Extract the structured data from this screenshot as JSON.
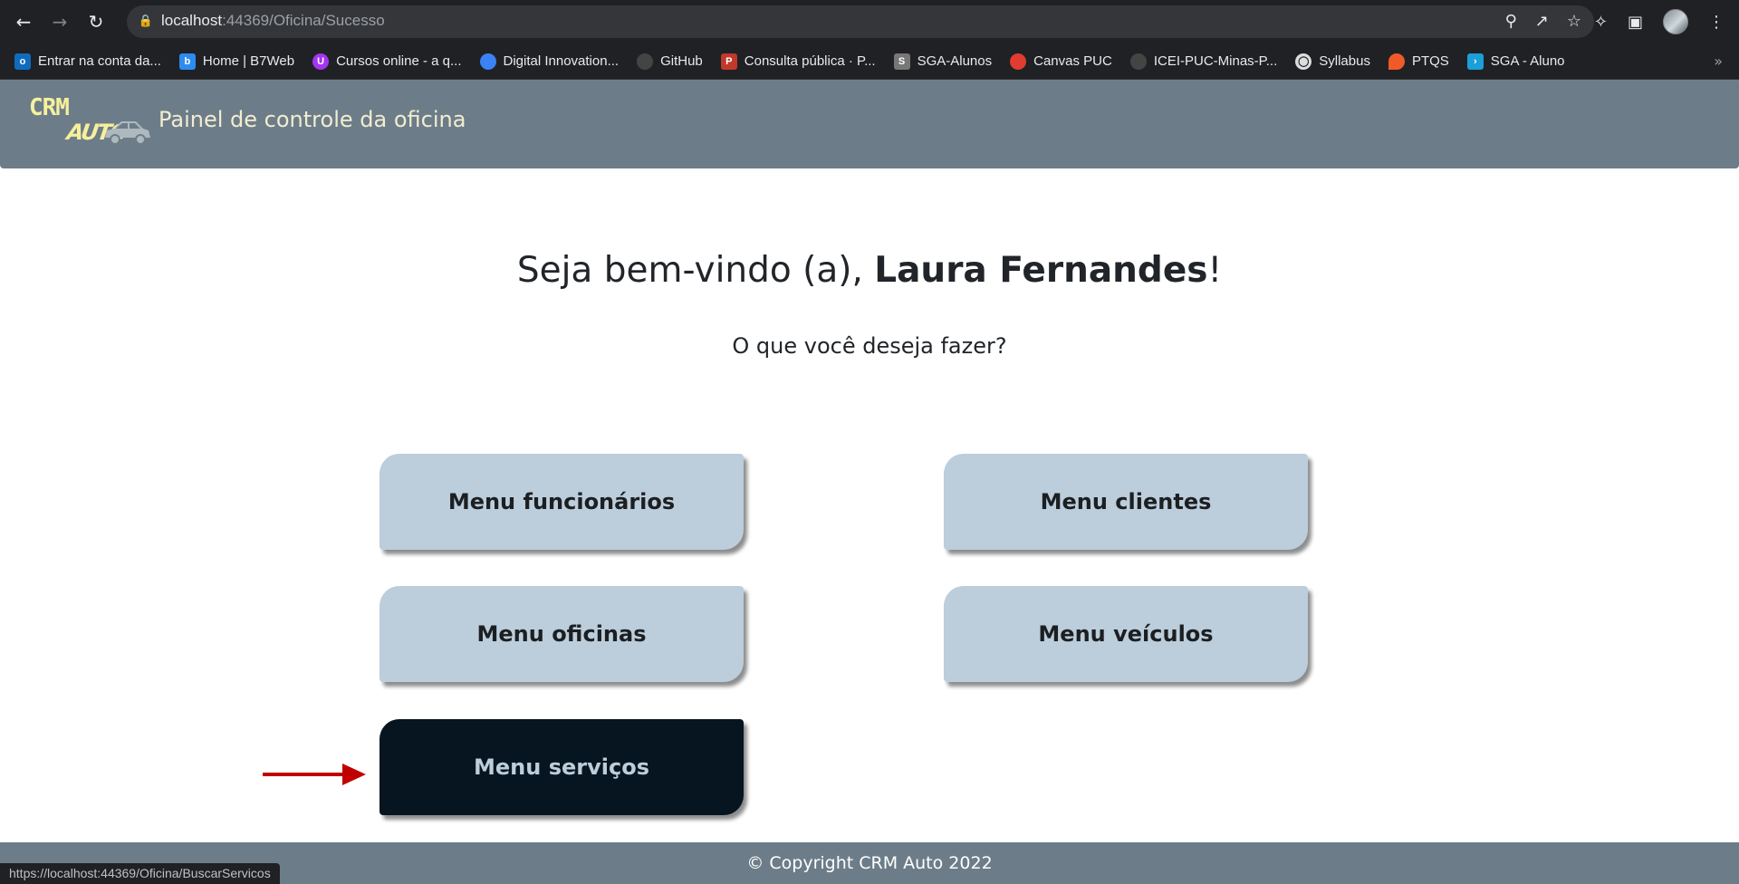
{
  "browser": {
    "url_host": "localhost",
    "url_path": ":44369/Oficina/Sucesso",
    "status_url": "https://localhost:44369/Oficina/BuscarServicos",
    "bookmarks": [
      {
        "label": "Entrar na conta da...",
        "icon": "outlook-icon",
        "color": "#0f6cbd"
      },
      {
        "label": "Home | B7Web",
        "icon": "b7web-icon",
        "color": "#2d8cf0"
      },
      {
        "label": "Cursos online - a q...",
        "icon": "udemy-icon",
        "color": "#a435f0"
      },
      {
        "label": "Digital Innovation...",
        "icon": "dio-icon",
        "color": "#3b82f6"
      },
      {
        "label": "GitHub",
        "icon": "github-icon",
        "color": "#444444"
      },
      {
        "label": "Consulta pública · P...",
        "icon": "consulta-icon",
        "color": "#c0392b"
      },
      {
        "label": "SGA-Alunos",
        "icon": "sga-icon",
        "color": "#777777"
      },
      {
        "label": "Canvas PUC",
        "icon": "canvas-icon",
        "color": "#e03c31"
      },
      {
        "label": "ICEI-PUC-Minas-P...",
        "icon": "github-icon",
        "color": "#444444"
      },
      {
        "label": "Syllabus",
        "icon": "globe-icon",
        "color": "#dddddd"
      },
      {
        "label": "PTQS",
        "icon": "flame-icon",
        "color": "#f05a28"
      },
      {
        "label": "SGA - Aluno",
        "icon": "sga-aluno-icon",
        "color": "#1a9fd6"
      }
    ]
  },
  "header": {
    "logo_top": "CRM",
    "logo_bottom": "AUTO",
    "title": "Painel de controle da oficina"
  },
  "main": {
    "welcome_prefix": "Seja bem-vindo (a), ",
    "user_name": "Laura Fernandes",
    "welcome_suffix": "!",
    "question": "O que você deseja fazer?",
    "buttons": {
      "funcionarios": "Menu funcionários",
      "clientes": "Menu clientes",
      "oficinas": "Menu oficinas",
      "veiculos": "Menu veículos",
      "servicos": "Menu serviços"
    }
  },
  "footer": {
    "copyright": "© Copyright CRM Auto 2022"
  },
  "colors": {
    "header_bg": "#6c7d89",
    "button_bg": "#bccddb",
    "button_active_bg": "#06151f",
    "arrow": "#c00000"
  }
}
